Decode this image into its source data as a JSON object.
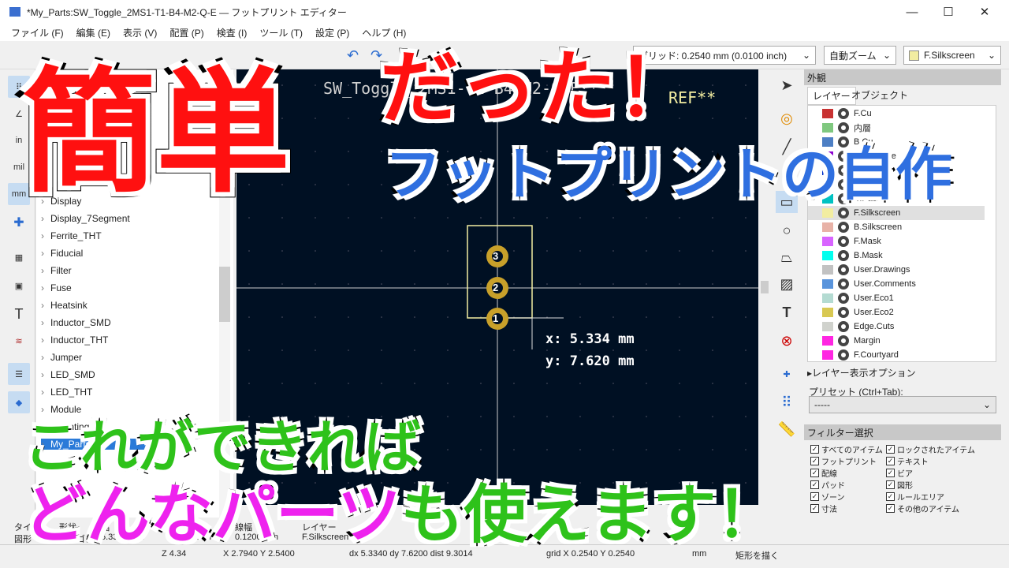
{
  "window": {
    "title": "*My_Parts:SW_Toggle_2MS1-T1-B4-M2-Q-E — フットプリント エディター",
    "minimize": "—",
    "maximize": "☐",
    "close": "✕"
  },
  "menu": [
    "ファイル (F)",
    "編集 (E)",
    "表示 (V)",
    "配置 (P)",
    "検査 (I)",
    "ツール (T)",
    "設定 (P)",
    "ヘルプ (H)"
  ],
  "toolbar": {
    "grid": "グリッド: 0.2540 mm (0.0100 inch)",
    "zoom": "自動ズーム",
    "layer": "F.Silkscreen",
    "layer_color": "#f2eda1"
  },
  "left_toolbar": {
    "in": "in",
    "mil": "mil",
    "mm": "mm"
  },
  "library_tree": [
    "Display",
    "Display_7Segment",
    "Ferrite_THT",
    "Fiducial",
    "Filter",
    "Fuse",
    "Heatsink",
    "Inductor_SMD",
    "Inductor_THT",
    "Jumper",
    "LED_SMD",
    "LED_THT",
    "Module",
    "Mounting",
    "My_Parts"
  ],
  "canvas": {
    "value_text": "SW_Toggle_2MS1-T1-B4-M2-Q-E**",
    "ref_text": "REF**",
    "pads": [
      "3",
      "2",
      "1"
    ],
    "cursor_x": "x: 5.334 mm",
    "cursor_y": "y: 7.620 mm"
  },
  "appearance": {
    "title": "外観",
    "tabs": [
      "レイヤー",
      "オブジェクト"
    ],
    "layers": [
      {
        "name": "F.Cu",
        "color": "#c83232"
      },
      {
        "name": "内層",
        "color": "#7fc87f"
      },
      {
        "name": "B.Cu",
        "color": "#4d7fc4"
      },
      {
        "name": "F.Adhesive",
        "color": "#8c00d0"
      },
      {
        "name": "B.Adhesive",
        "color": "#0030c8"
      },
      {
        "name": "F.Paste",
        "color": "#b4a0a0"
      },
      {
        "name": "B.Paste",
        "color": "#00c2c2"
      },
      {
        "name": "F.Silkscreen",
        "color": "#f2eda1",
        "selected": true
      },
      {
        "name": "B.Silkscreen",
        "color": "#e8b2a7"
      },
      {
        "name": "F.Mask",
        "color": "#d864ff"
      },
      {
        "name": "B.Mask",
        "color": "#02ffee"
      },
      {
        "name": "User.Drawings",
        "color": "#c2c2c2"
      },
      {
        "name": "User.Comments",
        "color": "#5994dc"
      },
      {
        "name": "User.Eco1",
        "color": "#b4dbd2"
      },
      {
        "name": "User.Eco2",
        "color": "#d8c852"
      },
      {
        "name": "Edge.Cuts",
        "color": "#d0d2cd"
      },
      {
        "name": "Margin",
        "color": "#ff26e2"
      },
      {
        "name": "F.Courtyard",
        "color": "#ff26e2"
      }
    ],
    "layer_options": "▸レイヤー表示オプション",
    "preset_label": "プリセット (Ctrl+Tab):",
    "preset_value": "-----"
  },
  "filter": {
    "title": "フィルター選択",
    "items": [
      "すべてのアイテム",
      "ロックされたアイテム",
      "フットプリント",
      "テキスト",
      "配線",
      "ビア",
      "パッド",
      "図形",
      "ゾーン",
      "ルールエリア",
      "寸法",
      "その他のアイテム"
    ]
  },
  "info": {
    "headers": [
      "タイプ",
      "形状",
      "幅",
      "高さ",
      "線幅",
      "レイヤー"
    ],
    "values": [
      "図形",
      "ポリゴン",
      "5.3340 mm",
      "7.6200 mm",
      "0.1200 mm",
      "F.Silkscreen"
    ]
  },
  "status": {
    "zoom": "Z 4.34",
    "xy": "X 2.7940  Y 2.5400",
    "delta": "dx 5.3340  dy 7.6200  dist 9.3014",
    "grid": "grid X 0.2540  Y 0.2540",
    "units": "mm",
    "action": "矩形を描く"
  },
  "overlay": {
    "big": "簡単",
    "big2": "だった！",
    "sub": "フットプリントの自作",
    "line1": "これができれば",
    "line2a": "どんなパーツ",
    "line2b": "も使えます！",
    "colors": {
      "red": "#ff1010",
      "blue": "#2f6fe0",
      "green": "#2ec21a",
      "magenta": "#ee22ee"
    }
  }
}
